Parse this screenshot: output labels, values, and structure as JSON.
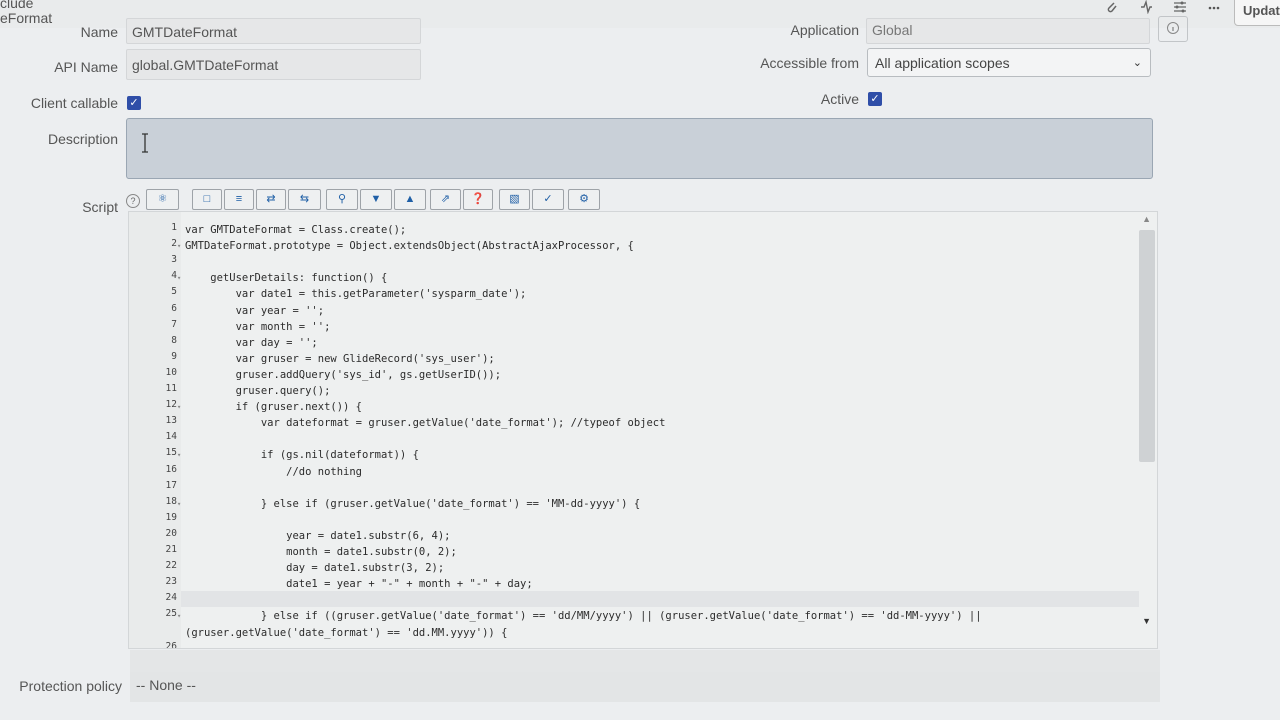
{
  "header": {
    "record_title_line1": "clude",
    "record_title_line2": "eFormat",
    "update_label": "Updat"
  },
  "form": {
    "name_label": "Name",
    "name_value": "GMTDateFormat",
    "application_label": "Application",
    "application_value": "Global",
    "api_name_label": "API Name",
    "api_name_value": "global.GMTDateFormat",
    "accessible_from_label": "Accessible from",
    "accessible_from_value": "All application scopes",
    "client_callable_label": "Client callable",
    "client_callable_checked": true,
    "active_label": "Active",
    "active_checked": true,
    "description_label": "Description",
    "description_value": "",
    "script_label": "Script",
    "protection_policy_label": "Protection policy",
    "protection_policy_value": "-- None --"
  },
  "toolbar_icons": [
    "help-icon",
    "toggle-syntax-icon",
    "comment-icon",
    "format-icon",
    "replace-icon",
    "replace-all-icon",
    "search-icon",
    "next-icon",
    "previous-icon",
    "fullscreen-icon",
    "script-debugger-icon",
    "save-icon",
    "script-search-icon",
    "syntax-check-icon"
  ],
  "script": {
    "lines": [
      {
        "n": "1",
        "fold": false,
        "code": "var GMTDateFormat = Class.create();"
      },
      {
        "n": "2",
        "fold": true,
        "code": "GMTDateFormat.prototype = Object.extendsObject(AbstractAjaxProcessor, {"
      },
      {
        "n": "3",
        "fold": false,
        "code": ""
      },
      {
        "n": "4",
        "fold": true,
        "code": "    getUserDetails: function() {"
      },
      {
        "n": "5",
        "fold": false,
        "code": "        var date1 = this.getParameter('sysparm_date');"
      },
      {
        "n": "6",
        "fold": false,
        "code": "        var year = '';"
      },
      {
        "n": "7",
        "fold": false,
        "code": "        var month = '';"
      },
      {
        "n": "8",
        "fold": false,
        "code": "        var day = '';"
      },
      {
        "n": "9",
        "fold": false,
        "code": "        var gruser = new GlideRecord('sys_user');"
      },
      {
        "n": "10",
        "fold": false,
        "code": "        gruser.addQuery('sys_id', gs.getUserID());"
      },
      {
        "n": "11",
        "fold": false,
        "code": "        gruser.query();"
      },
      {
        "n": "12",
        "fold": true,
        "code": "        if (gruser.next()) {"
      },
      {
        "n": "13",
        "fold": false,
        "code": "            var dateformat = gruser.getValue('date_format'); //typeof object"
      },
      {
        "n": "14",
        "fold": false,
        "code": ""
      },
      {
        "n": "15",
        "fold": true,
        "code": "            if (gs.nil(dateformat)) {"
      },
      {
        "n": "16",
        "fold": false,
        "code": "                //do nothing"
      },
      {
        "n": "17",
        "fold": false,
        "code": ""
      },
      {
        "n": "18",
        "fold": true,
        "code": "            } else if (gruser.getValue('date_format') == 'MM-dd-yyyy') {"
      },
      {
        "n": "19",
        "fold": false,
        "code": ""
      },
      {
        "n": "20",
        "fold": false,
        "code": "                year = date1.substr(6, 4);"
      },
      {
        "n": "21",
        "fold": false,
        "code": "                month = date1.substr(0, 2);"
      },
      {
        "n": "22",
        "fold": false,
        "code": "                day = date1.substr(3, 2);"
      },
      {
        "n": "23",
        "fold": false,
        "code": "                date1 = year + \"-\" + month + \"-\" + day;"
      },
      {
        "n": "24",
        "fold": false,
        "code": ""
      },
      {
        "n": "25",
        "fold": true,
        "code": "            } else if ((gruser.getValue('date_format') == 'dd/MM/yyyy') || (gruser.getValue('date_format') == 'dd-MM-yyyy') ||"
      },
      {
        "n": "",
        "fold": false,
        "code": "(gruser.getValue('date_format') == 'dd.MM.yyyy')) {"
      },
      {
        "n": "26",
        "fold": false,
        "code": ""
      }
    ]
  }
}
